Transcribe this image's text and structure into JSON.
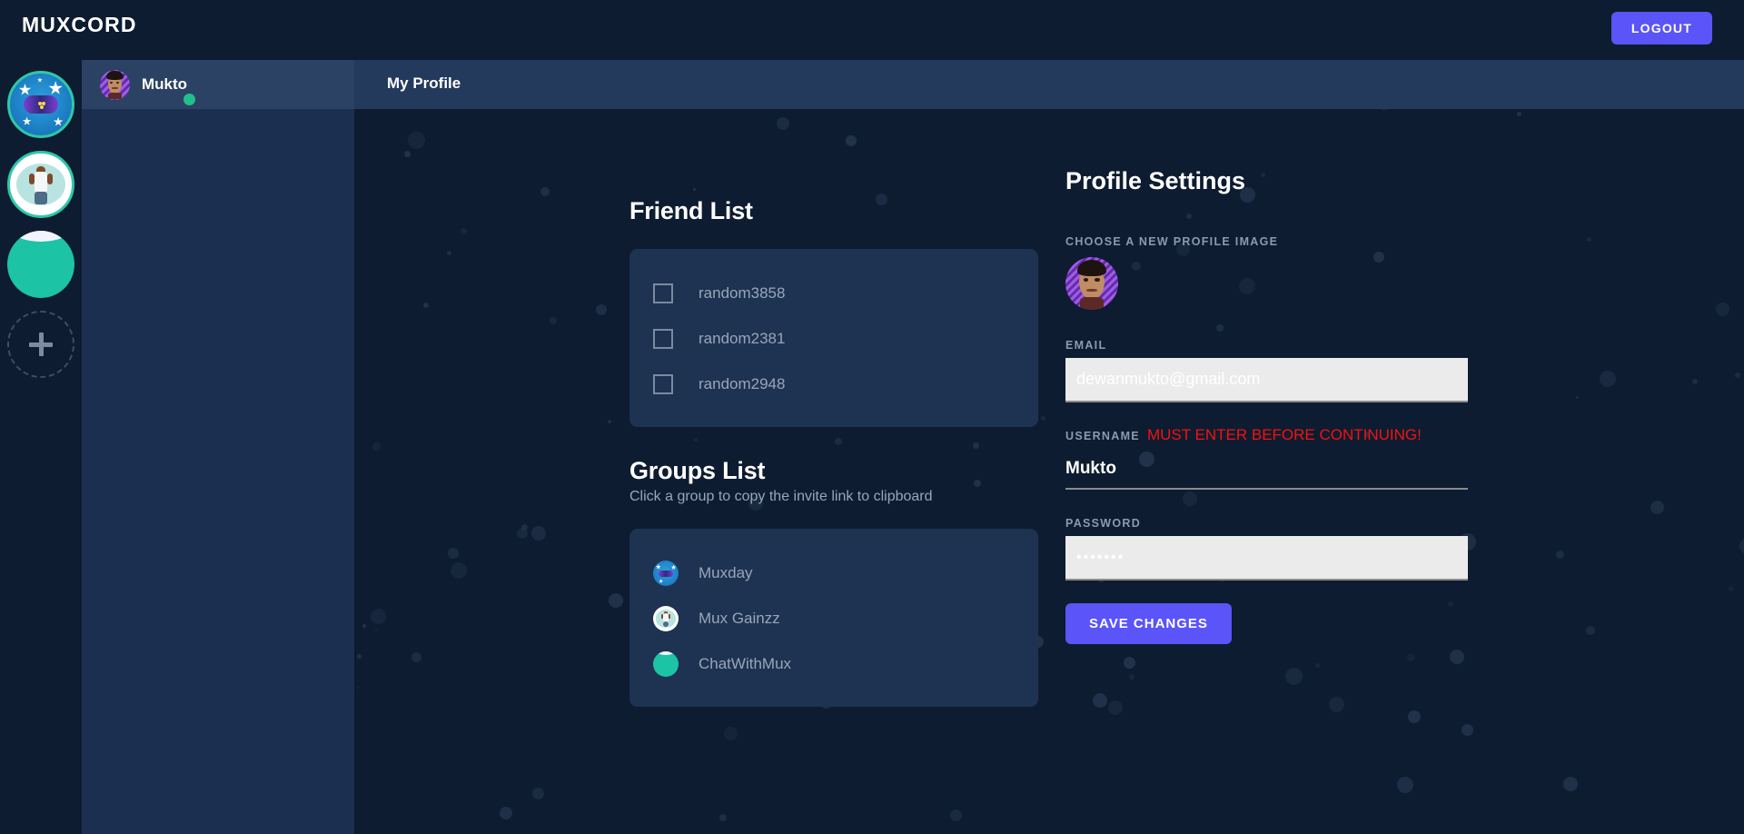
{
  "app": {
    "brand": "MUXCORD",
    "logout_label": "LOGOUT",
    "accent_color": "#5a54f9",
    "background_color": "#0d1c30",
    "panel_color": "#1b3050",
    "card_color": "#1e3251",
    "warning_color": "#f51111",
    "online_color": "#21c08a"
  },
  "server_rail": {
    "items": [
      {
        "name": "gamer-server-icon",
        "label": ""
      },
      {
        "name": "muxgainzz-server-icon",
        "label": ""
      },
      {
        "name": "chatwithmux-server-icon",
        "label": ""
      }
    ],
    "add_label": "+"
  },
  "dm_panel": {
    "user": {
      "name": "Mukto",
      "status": "online",
      "avatar_name": "mukto-avatar"
    }
  },
  "content_header": {
    "tab_label": "My Profile"
  },
  "friend_list": {
    "title": "Friend List",
    "items": [
      {
        "name": "random3858",
        "checked": false
      },
      {
        "name": "random2381",
        "checked": false
      },
      {
        "name": "random2948",
        "checked": false
      }
    ]
  },
  "groups_list": {
    "title": "Groups List",
    "subtitle": "Click a group to copy the invite link to clipboard",
    "items": [
      {
        "name": "Muxday",
        "avatar": "gamer-avatar"
      },
      {
        "name": "Mux Gainzz",
        "avatar": "buff-avatar"
      },
      {
        "name": "ChatWithMux",
        "avatar": "teal-avatar"
      }
    ]
  },
  "profile_settings": {
    "title": "Profile Settings",
    "profile_image_label": "CHOOSE A NEW PROFILE IMAGE",
    "email_label": "EMAIL",
    "email_value": "dewanmukto@gmail.com",
    "email_placeholder": "dewanmukto@gmail.com",
    "username_label": "USERNAME",
    "username_warning": "MUST ENTER BEFORE CONTINUING!",
    "username_value": "Mukto",
    "username_placeholder": "Mukto",
    "password_label": "PASSWORD",
    "password_value": "•••••••",
    "password_placeholder": "•••••••",
    "save_label": "SAVE CHANGES"
  }
}
